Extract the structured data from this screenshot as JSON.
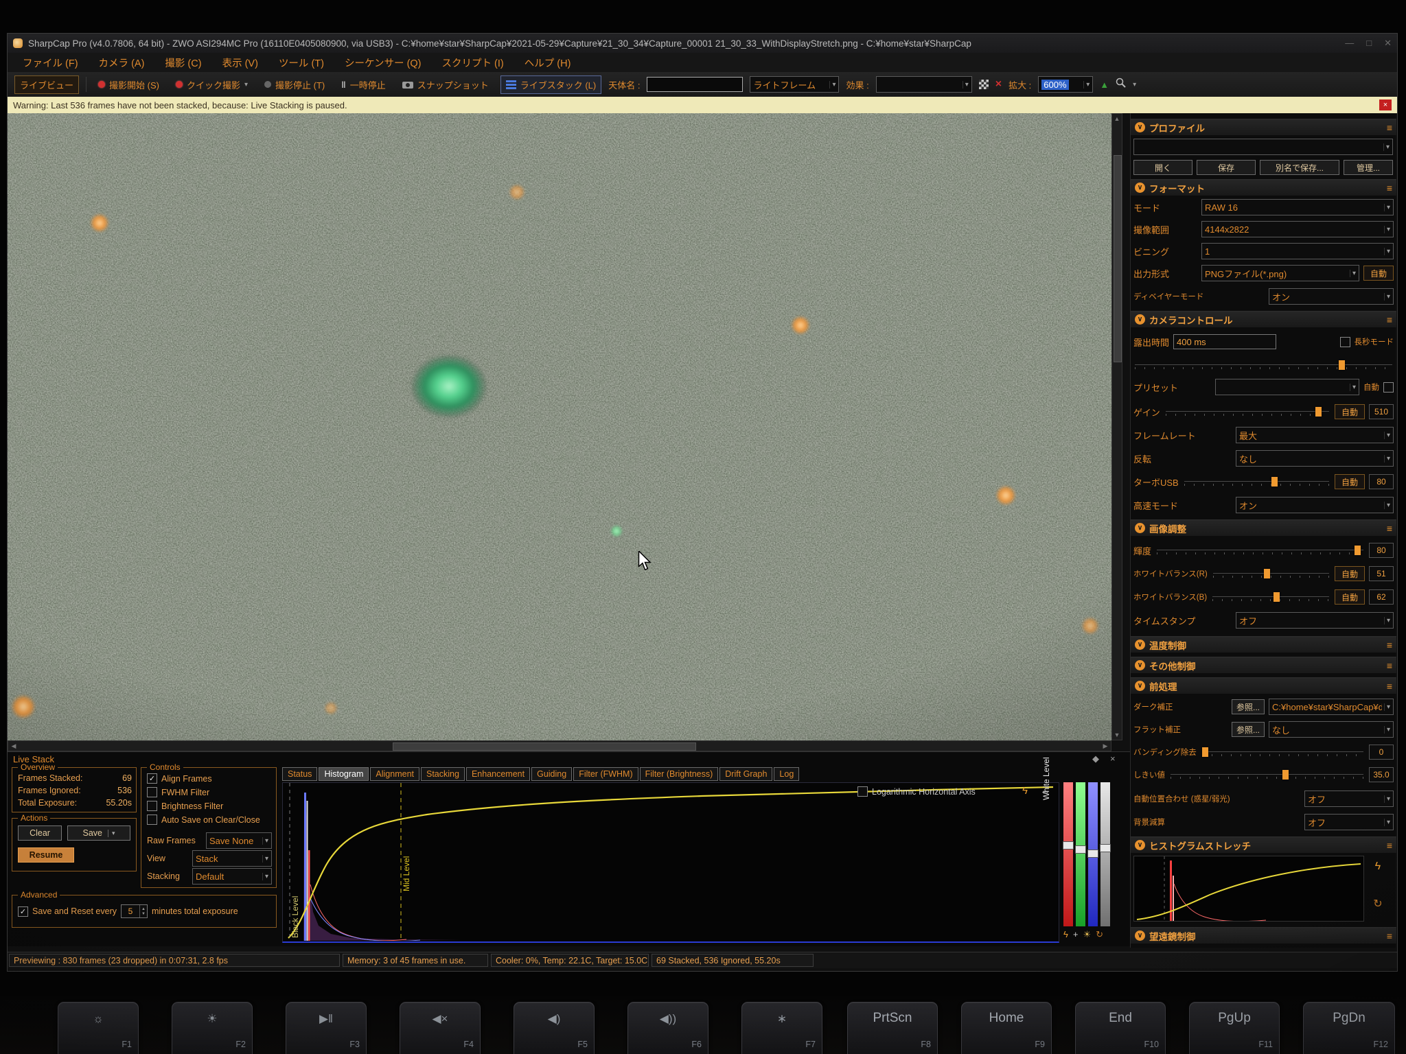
{
  "window": {
    "title": "SharpCap Pro (v4.0.7806, 64 bit) - ZWO ASI294MC Pro (16110E0405080900, via USB3) - C:¥home¥star¥SharpCap¥2021-05-29¥Capture¥21_30_34¥Capture_00001 21_30_33_WithDisplayStretch.png - C:¥home¥star¥SharpCap",
    "minimize": "—",
    "maximize": "□",
    "close": "✕",
    "menu": [
      "ファイル (F)",
      "カメラ (A)",
      "撮影 (C)",
      "表示 (V)",
      "ツール (T)",
      "シーケンサー (Q)",
      "スクリプト (I)",
      "ヘルプ (H)"
    ]
  },
  "toolbar": {
    "live_view": "ライブビュー",
    "capture_start": "撮影開始 (S)",
    "quick_capture": "クイック撮影",
    "capture_stop": "撮影停止 (T)",
    "pause": "一時停止",
    "snapshot": "スナップショット",
    "live_stack": "ライブスタック (L)",
    "object_label": "天体名 :",
    "object_value": "",
    "frame_type": "ライトフレーム",
    "effects_label": "効果 :",
    "effects_value": "",
    "zoom_label": "拡大 :",
    "zoom_value": "600%"
  },
  "warning": {
    "text": "Warning: Last 536 frames have not been stacked, because: Live Stacking is paused."
  },
  "right_panel": {
    "profile": {
      "title": "プロファイル",
      "open": "開く",
      "save": "保存",
      "save_as": "別名で保存...",
      "manage": "管理..."
    },
    "format": {
      "title": "フォーマット",
      "mode_label": "モード",
      "mode_value": "RAW 16",
      "area_label": "撮像範囲",
      "area_value": "4144x2822",
      "binning_label": "ビニング",
      "binning_value": "1",
      "output_label": "出力形式",
      "output_value": "PNGファイル(*.png)",
      "output_auto": "自動",
      "debayer_label": "ディベイヤーモード",
      "debayer_value": "オン"
    },
    "camera": {
      "title": "カメラコントロール",
      "exposure_label": "露出時間",
      "exposure_value": "400 ms",
      "long_exp": "長秒モード",
      "preset_label": "プリセット",
      "preset_value": "",
      "preset_auto": "自動",
      "gain_label": "ゲイン",
      "gain_auto": "自動",
      "gain_value": "510",
      "framerate_label": "フレームレート",
      "framerate_value": "最大",
      "flip_label": "反転",
      "flip_value": "なし",
      "usb_label": "ターボUSB",
      "usb_auto": "自動",
      "usb_value": "80",
      "highspeed_label": "高速モード",
      "highspeed_value": "オン"
    },
    "image": {
      "title": "画像調整",
      "brightness_label": "輝度",
      "brightness_value": "80",
      "wb_r_label": "ホワイトバランス(R)",
      "wb_r_auto": "自動",
      "wb_r_value": "51",
      "wb_b_label": "ホワイトバランス(B)",
      "wb_b_auto": "自動",
      "wb_b_value": "62",
      "timestamp_label": "タイムスタンプ",
      "timestamp_value": "オフ"
    },
    "thermal": {
      "title": "温度制御"
    },
    "misc": {
      "title": "その他制御"
    },
    "preprocess": {
      "title": "前処理",
      "dark_label": "ダーク補正",
      "dark_browse": "参照...",
      "dark_value": "C:¥home¥star¥SharpCap¥darks¥ZWO…",
      "flat_label": "フラット補正",
      "flat_browse": "参照...",
      "flat_value": "なし",
      "banding_label": "バンディング除去",
      "banding_value": "0",
      "threshold_label": "しきい値",
      "threshold_value": "35.0",
      "align_label": "自動位置合わせ (惑星/弱光)",
      "align_value": "オフ",
      "bg_label": "背景減算",
      "bg_value": "オフ"
    },
    "stretch": {
      "title": "ヒストグラムストレッチ"
    },
    "telescope": {
      "title": "望遠鏡制御"
    }
  },
  "live_stack": {
    "title": "Live Stack",
    "overview": {
      "title": "Overview",
      "stacked_label": "Frames Stacked:",
      "stacked_value": "69",
      "ignored_label": "Frames Ignored:",
      "ignored_value": "536",
      "exposure_label": "Total Exposure:",
      "exposure_value": "55.20s"
    },
    "actions": {
      "title": "Actions",
      "clear": "Clear",
      "save": "Save",
      "resume": "Resume"
    },
    "controls": {
      "title": "Controls",
      "align": "Align Frames",
      "fwhm": "FWHM Filter",
      "brightness": "Brightness Filter",
      "autosave": "Auto Save on Clear/Close",
      "raw_label": "Raw Frames",
      "raw_value": "Save None",
      "view_label": "View",
      "view_value": "Stack",
      "stacking_label": "Stacking",
      "stacking_value": "Default"
    },
    "advanced": {
      "title": "Advanced",
      "prefix": "Save and Reset every",
      "minutes": "5",
      "suffix": "minutes total exposure"
    }
  },
  "stack_tabs": [
    "Status",
    "Histogram",
    "Alignment",
    "Stacking",
    "Enhancement",
    "Guiding",
    "Filter (FWHM)",
    "Filter (Brightness)",
    "Drift Graph",
    "Log"
  ],
  "histogram": {
    "log_axis": "Logarithmic Horizontal Axis",
    "black_level": "Black Level",
    "mid_level": "Mid Level",
    "white_level": "White Level"
  },
  "status_bar": [
    "Previewing : 830 frames (23 dropped) in 0:07:31, 2.8 fps",
    "Memory: 3 of 45 frames in use.",
    "Cooler: 0%, Temp: 22.1C, Target: 15.0C",
    "69 Stacked, 536 Ignored, 55.20s"
  ],
  "keyboard": [
    {
      "icon": "☼",
      "flabel": "F1"
    },
    {
      "icon": "☀",
      "flabel": "F2"
    },
    {
      "icon": "▶‖",
      "flabel": "F3"
    },
    {
      "icon": "◀×",
      "flabel": "F4"
    },
    {
      "icon": "◀)",
      "flabel": "F5"
    },
    {
      "icon": "◀))",
      "flabel": "F6"
    },
    {
      "icon": "∗",
      "flabel": "F7"
    },
    {
      "main": "PrtScn",
      "flabel": "F8"
    },
    {
      "main": "Home",
      "flabel": "F9"
    },
    {
      "main": "End",
      "flabel": "F10"
    },
    {
      "main": "PgUp",
      "flabel": "F11"
    },
    {
      "main": "PgDn",
      "flabel": "F12"
    }
  ],
  "icons": {
    "chevron_down": "▾",
    "section_chevron": "∨",
    "burger": "≡",
    "check": "✓",
    "close": "×",
    "pin": "◆",
    "up": "▲",
    "down": "▼",
    "left": "◀",
    "right": "▶",
    "lightning": "ϟ",
    "reset": "↻",
    "sun": "☀",
    "plus": "+",
    "arrows": "↔",
    "pause": "‖"
  }
}
